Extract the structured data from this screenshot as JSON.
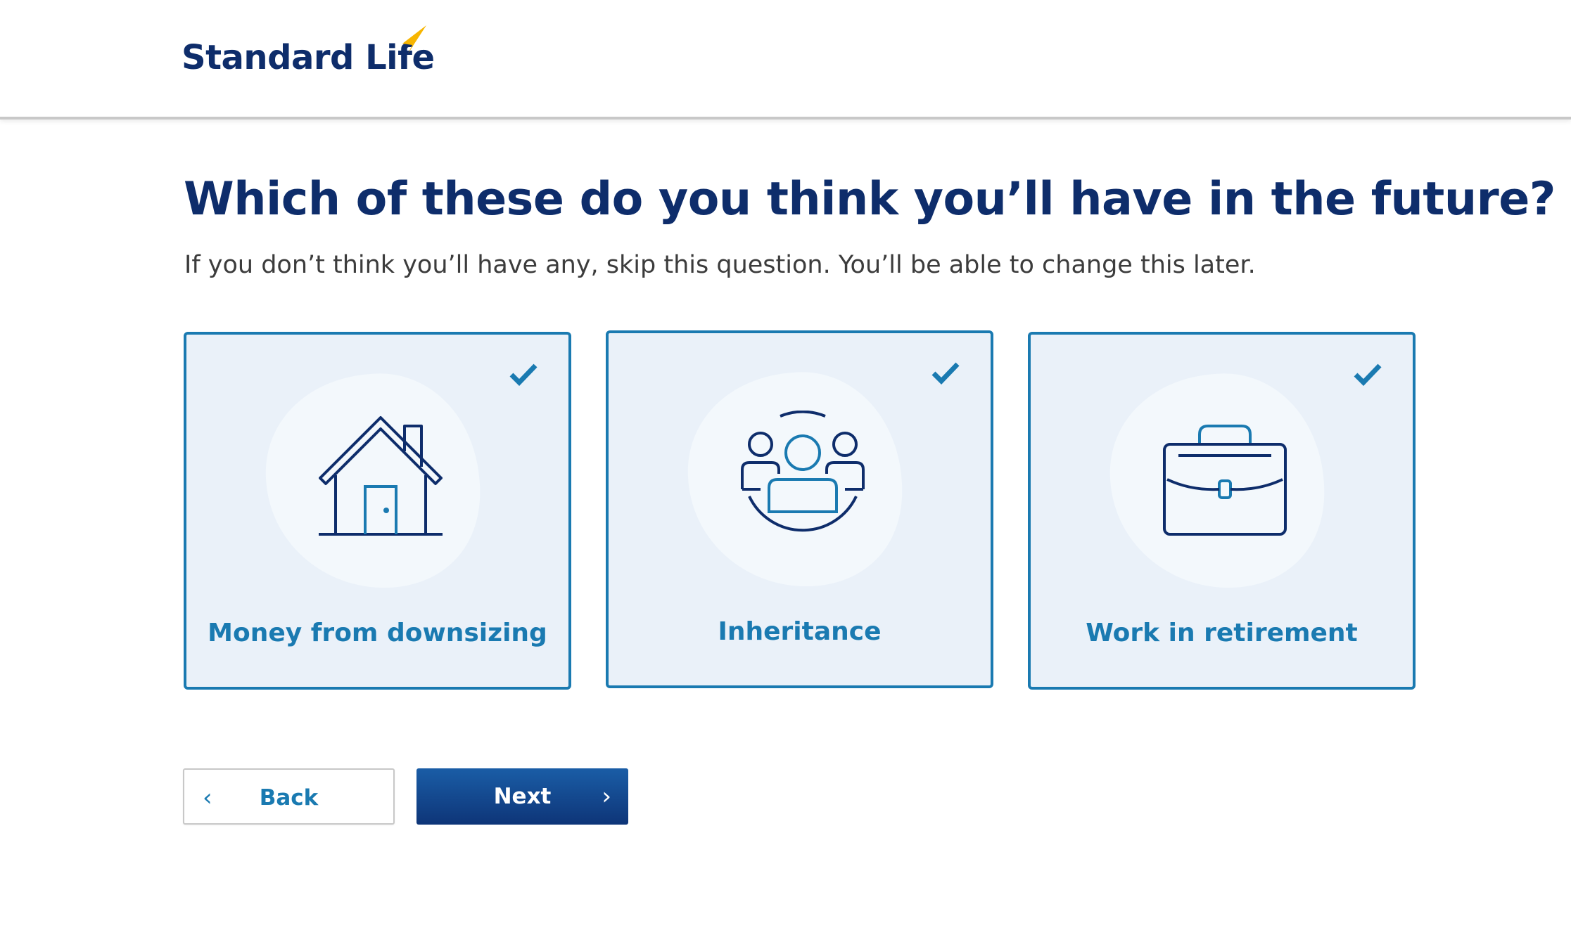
{
  "header": {
    "logo_text": "Standard Life",
    "colors": {
      "brand_navy": "#0e2d6b",
      "logo_accent": "#f7b500"
    }
  },
  "question": {
    "title": "Which of these do you think you’ll have in the future?",
    "subtitle": "If you don’t think you’ll have any, skip this question. You’ll be able to change this later."
  },
  "options": [
    {
      "label": "Money from downsizing",
      "icon": "house-icon",
      "selected": true
    },
    {
      "label": "Inheritance",
      "icon": "people-group-icon",
      "selected": true
    },
    {
      "label": "Work in retirement",
      "icon": "briefcase-icon",
      "selected": true
    }
  ],
  "navigation": {
    "back_label": "Back",
    "back_icon": "chevron-left-icon",
    "next_label": "Next",
    "next_icon": "chevron-right-icon"
  },
  "colors": {
    "card_background": "#eaf1f9",
    "card_border": "#1a7ab1",
    "accent_blue": "#1a7ab1",
    "next_button": "#0e3578"
  }
}
